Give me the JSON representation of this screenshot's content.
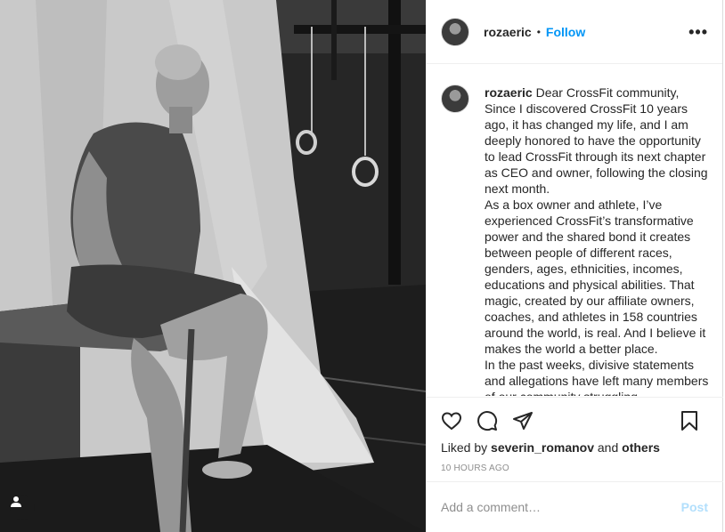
{
  "post": {
    "username": "rozaeric",
    "separator": "•",
    "follow_label": "Follow",
    "more_label": "•••"
  },
  "caption": {
    "username": "rozaeric",
    "paragraphs": [
      "Dear CrossFit community, Since I discovered CrossFit 10 years ago, it has changed my life, and I am deeply honored to have the opportunity to lead CrossFit through its next chapter as CEO and owner, following the closing next month.",
      "As a box owner and athlete, I’ve experienced CrossFit’s transformative power and the shared bond it creates between people of different races, genders, ages, ethnicities, incomes, educations and physical abilities. That magic, created by our affiliate owners, coaches, and athletes in 158 countries around the world, is real. And I believe it makes the world a better place.",
      "In the past weeks, divisive statements and allegations have left many members of our community struggling"
    ]
  },
  "actions": {
    "like_icon": "heart-icon",
    "comment_icon": "comment-icon",
    "share_icon": "share-icon",
    "save_icon": "bookmark-icon"
  },
  "likes": {
    "prefix": "Liked by",
    "liker": "severin_romanov",
    "conjunction": "and",
    "others": "others"
  },
  "timestamp": "10 HOURS AGO",
  "comment": {
    "placeholder": "Add a comment…",
    "value": "",
    "post_label": "Post"
  },
  "colors": {
    "link_blue": "#0095f6",
    "post_disabled": "#b2dffc",
    "muted_text": "#8e8e8e"
  }
}
